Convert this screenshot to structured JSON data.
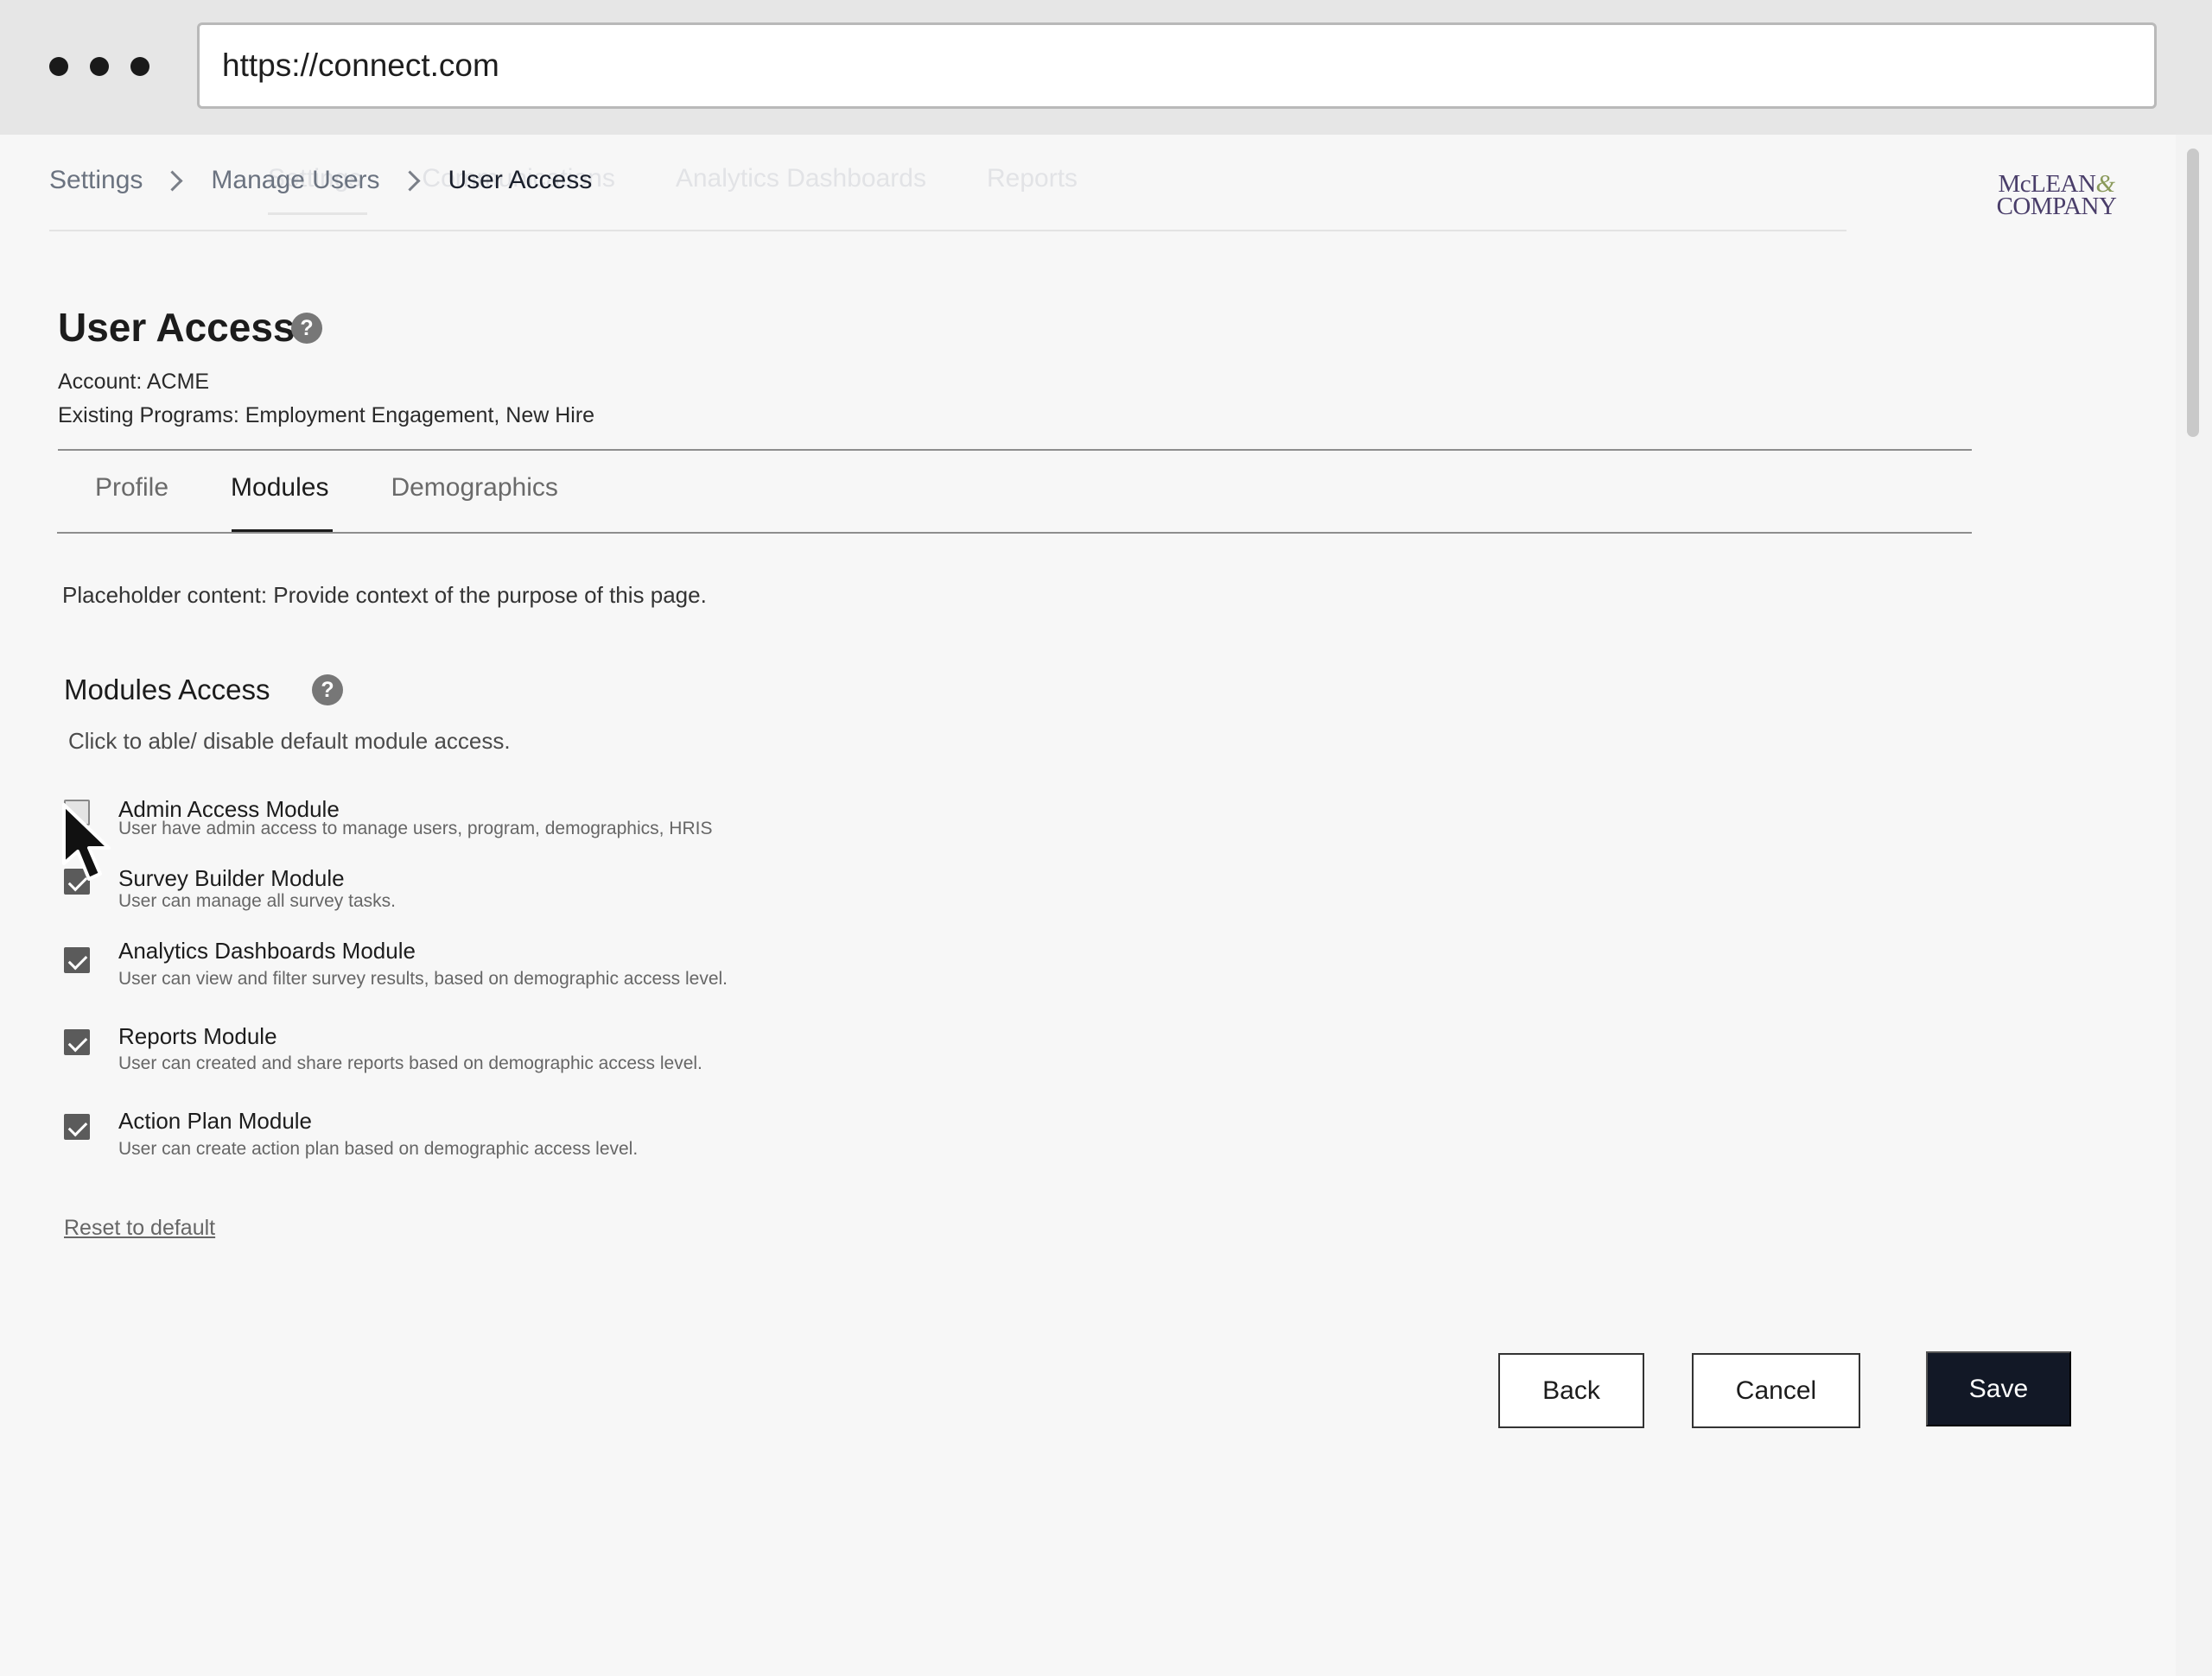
{
  "browser": {
    "url": "https://connect.com"
  },
  "ghost_nav": [
    "Settings",
    "Communications",
    "Analytics Dashboards",
    "Reports"
  ],
  "breadcrumb": {
    "items": [
      "Settings",
      "Manage Users",
      "User Access"
    ]
  },
  "logo": {
    "line1": "McLEAN",
    "amp": "&",
    "line2": "COMPANY"
  },
  "header": {
    "title": "User Access",
    "help_glyph": "?",
    "account": "Account: ACME",
    "programs": "Existing Programs:  Employment Engagement, New Hire"
  },
  "tabs": [
    {
      "label": "Profile",
      "active": false
    },
    {
      "label": "Modules",
      "active": true
    },
    {
      "label": "Demographics",
      "active": false
    }
  ],
  "context_text": "Placeholder content: Provide context of the purpose of this page.",
  "modules_section": {
    "title": "Modules Access",
    "help_glyph": "?",
    "description": "Click to able/ disable default module access.",
    "modules": [
      {
        "name": "Admin Access Module",
        "description": "User have admin access to manage users, program, demographics, HRIS",
        "checked": false
      },
      {
        "name": "Survey Builder Module",
        "description": "User can manage all survey tasks.",
        "checked": true
      },
      {
        "name": "Analytics Dashboards Module",
        "description": "User can view and filter survey results, based on demographic access level.",
        "checked": true
      },
      {
        "name": "Reports Module",
        "description": "User can created and share reports based on demographic access level.",
        "checked": true
      },
      {
        "name": "Action Plan Module",
        "description": "User can create action plan based on demographic access level.",
        "checked": true
      }
    ],
    "reset_label": "Reset to default"
  },
  "actions": {
    "back_label": "Back",
    "cancel_label": "Cancel",
    "save_label": "Save"
  },
  "colors": {
    "save_button": "#121826",
    "checkbox_checked": "#5b5b5b",
    "logo_text": "#4a3e6a",
    "logo_amp": "#8a9a5b"
  },
  "icons": {
    "help": "question-circle-icon",
    "breadcrumb_separator": "chevron-right-icon",
    "cursor": "mouse-pointer-icon"
  }
}
